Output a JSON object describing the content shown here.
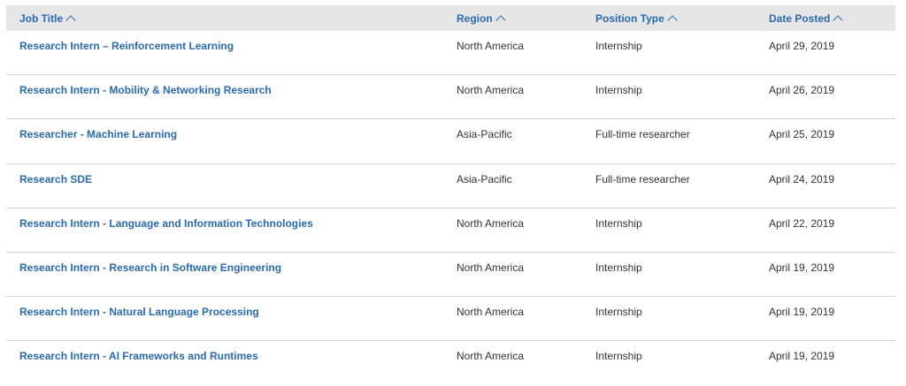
{
  "table": {
    "headers": {
      "title": "Job Title",
      "region": "Region",
      "type": "Position Type",
      "date": "Date Posted"
    },
    "rows": [
      {
        "title": "Research Intern – Reinforcement Learning",
        "region": "North America",
        "type": "Internship",
        "date": "April 29, 2019"
      },
      {
        "title": "Research Intern - Mobility & Networking Research",
        "region": "North America",
        "type": "Internship",
        "date": "April 26, 2019"
      },
      {
        "title": "Researcher - Machine Learning",
        "region": "Asia-Pacific",
        "type": "Full-time researcher",
        "date": "April 25, 2019"
      },
      {
        "title": "Research SDE",
        "region": "Asia-Pacific",
        "type": "Full-time researcher",
        "date": "April 24, 2019"
      },
      {
        "title": "Research Intern - Language and Information Technologies",
        "region": "North America",
        "type": "Internship",
        "date": "April 22, 2019"
      },
      {
        "title": "Research Intern - Research in Software Engineering",
        "region": "North America",
        "type": "Internship",
        "date": "April 19, 2019"
      },
      {
        "title": "Research Intern - Natural Language Processing",
        "region": "North America",
        "type": "Internship",
        "date": "April 19, 2019"
      },
      {
        "title": "Research Intern - AI Frameworks and Runtimes",
        "region": "North America",
        "type": "Internship",
        "date": "April 19, 2019"
      }
    ]
  },
  "colors": {
    "link": "#2a6ab0",
    "header_bg": "#e6e6e6",
    "divider": "#d2d2d2"
  },
  "icons": {
    "sort": "chevron-up-icon"
  }
}
